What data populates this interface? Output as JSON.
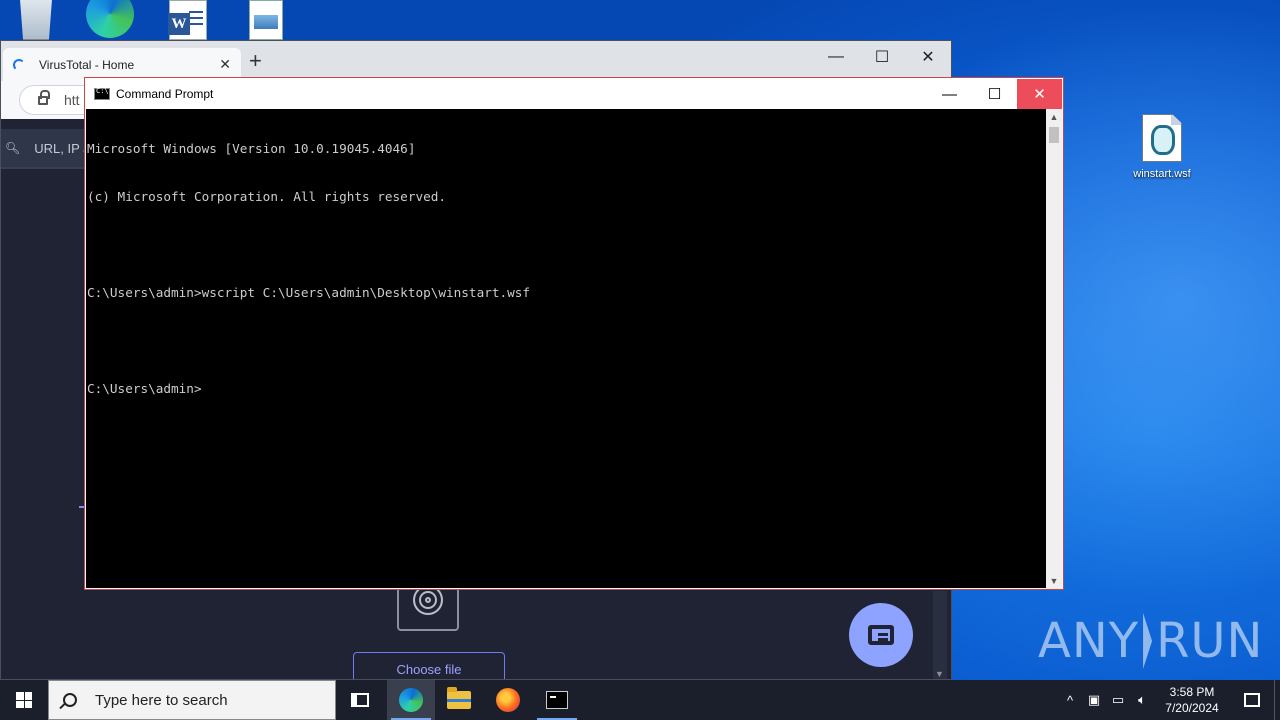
{
  "desktop": {
    "top_icons": [
      "recycle-bin",
      "edge",
      "word-document",
      "image-file"
    ],
    "wsf_file": {
      "label": "winstart.wsf"
    },
    "watermark": {
      "left": "ANY",
      "right": "RUN"
    }
  },
  "browser": {
    "tab_title": "VirusTotal - Home",
    "tab_close": "✕",
    "new_tab": "+",
    "controls": {
      "minimize": "—",
      "maximize": "☐",
      "close": "✕"
    },
    "address_text": "htt",
    "search_placeholder": "URL, IP ac",
    "choose_file_label": "Choose file",
    "scroll_down": "▼"
  },
  "cmd": {
    "title": "Command Prompt",
    "controls": {
      "minimize": "—",
      "maximize": "☐",
      "close": "✕"
    },
    "lines": [
      "Microsoft Windows [Version 10.0.19045.4046]",
      "(c) Microsoft Corporation. All rights reserved.",
      "",
      "C:\\Users\\admin>wscript C:\\Users\\admin\\Desktop\\winstart.wsf",
      "",
      "C:\\Users\\admin>"
    ],
    "scroll_up": "▲",
    "scroll_down": "▼"
  },
  "taskbar": {
    "search_placeholder": "Type here to search",
    "tray": {
      "chevron": "^",
      "time": "3:58 PM",
      "date": "7/20/2024"
    }
  },
  "colors": {
    "cmd_text": "#cccccc",
    "vt_accent": "#8ea2ff",
    "desktop_blue": "#0b5cd0"
  }
}
